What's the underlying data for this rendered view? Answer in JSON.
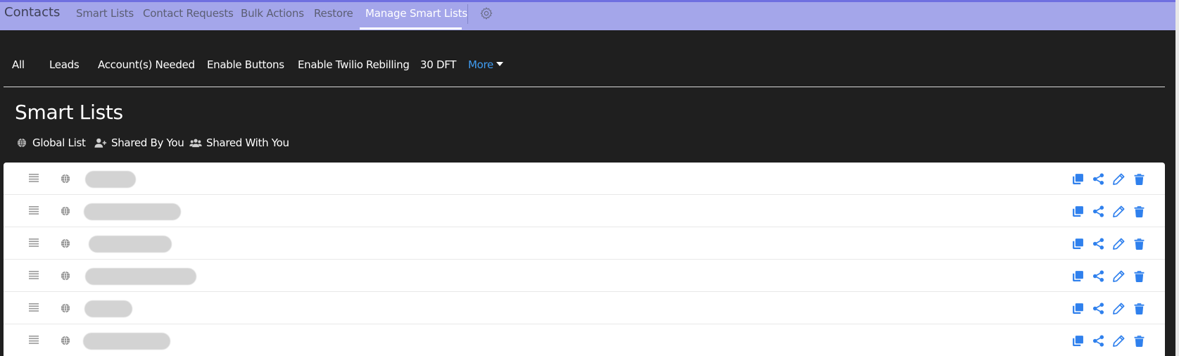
{
  "topnav": {
    "brand": "Contacts",
    "items": [
      {
        "label": "Smart Lists"
      },
      {
        "label": "Contact Requests"
      },
      {
        "label": "Bulk Actions"
      },
      {
        "label": "Restore"
      },
      {
        "label": "Manage Smart Lists",
        "active": true
      }
    ],
    "settings_icon": "gear-icon"
  },
  "list_tabs": [
    {
      "label": "All"
    },
    {
      "label": "Leads"
    },
    {
      "label": "Account(s) Needed"
    },
    {
      "label": "Enable Buttons"
    },
    {
      "label": "Enable Twilio Rebilling"
    },
    {
      "label": "30 DFT"
    }
  ],
  "more_label": "More",
  "page_title": "Smart Lists",
  "filters": [
    {
      "label": "Global List",
      "icon": "globe-icon"
    },
    {
      "label": "Shared By You",
      "icon": "user-plus-icon"
    },
    {
      "label": "Shared With You",
      "icon": "users-icon"
    }
  ],
  "smart_lists": {
    "row_count": 6,
    "name_state": "redacted",
    "row_icons": [
      "drag-handle-icon",
      "globe-icon"
    ],
    "actions": [
      "copy-icon",
      "share-icon",
      "edit-icon",
      "delete-icon"
    ]
  },
  "colors": {
    "nav_bg": "#a4a6ea",
    "accent_line": "#6f6fe0",
    "page_bg": "#1f1f1f",
    "link_blue": "#3f9bf0",
    "action_blue": "#2f80ed"
  }
}
